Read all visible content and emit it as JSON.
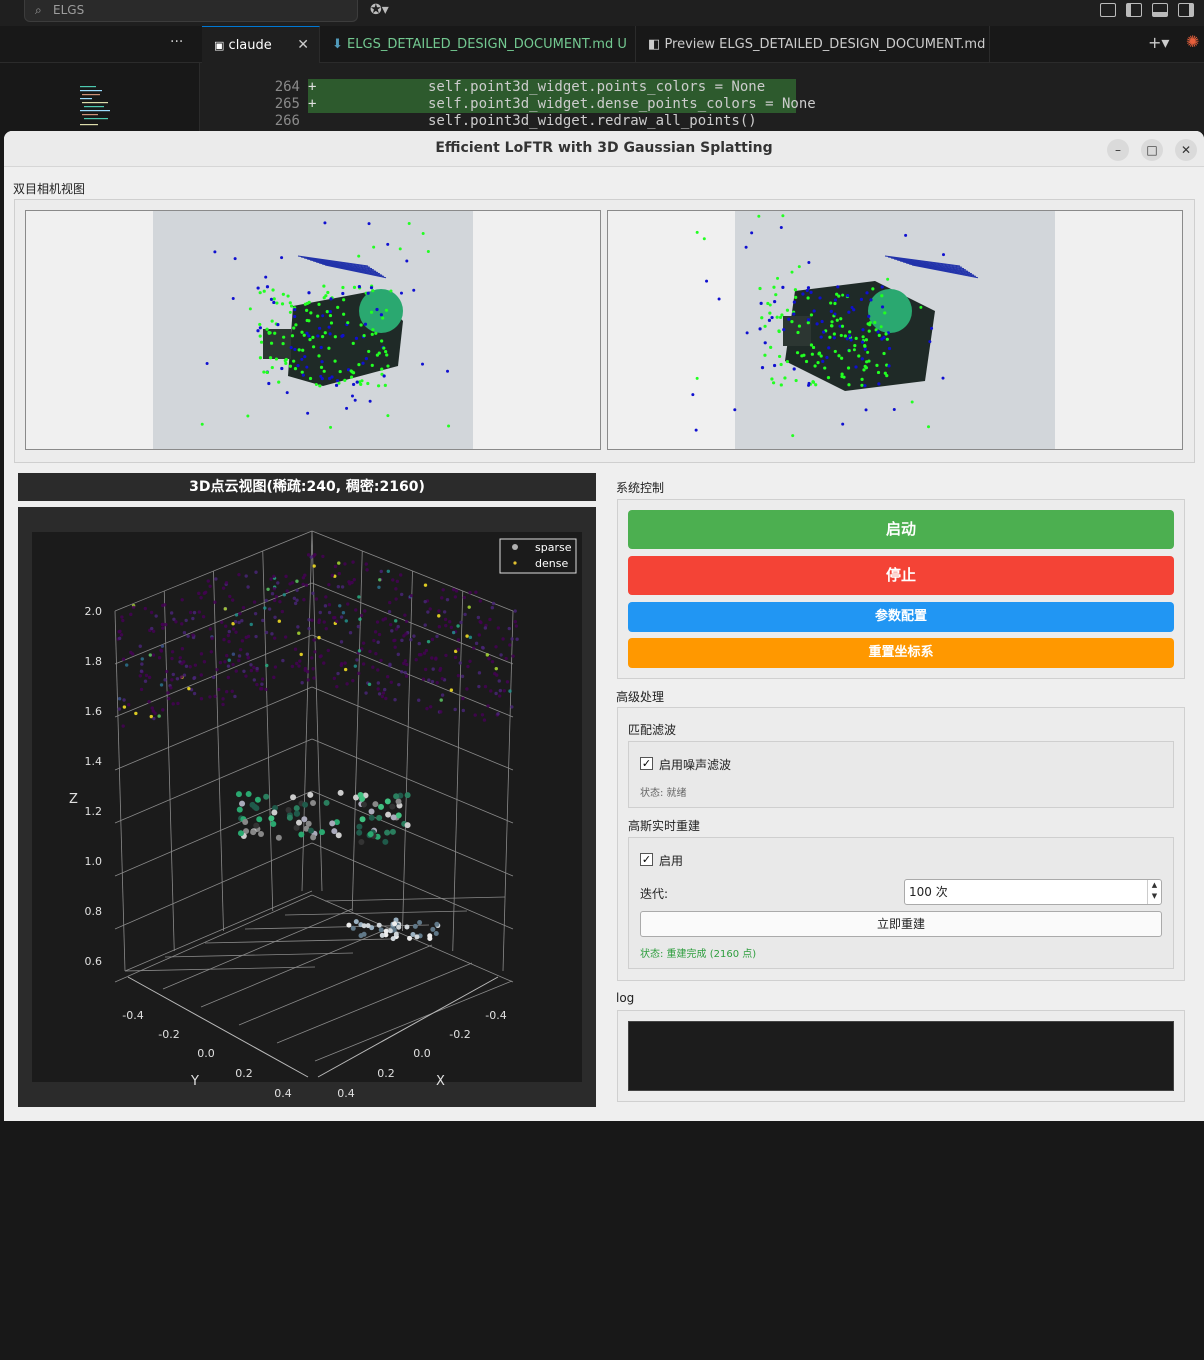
{
  "vscode": {
    "search_text": "ELGS",
    "tabs": [
      {
        "label": "claude",
        "icon": "terminal-icon",
        "active": true
      },
      {
        "label": "ELGS_DETAILED_DESIGN_DOCUMENT.md",
        "badge": "U",
        "icon": "markdown-icon"
      },
      {
        "label": "Preview ELGS_DETAILED_DESIGN_DOCUMENT.md",
        "icon": "preview-icon"
      }
    ],
    "code_lines": [
      {
        "num": "264",
        "marker": "+",
        "text": "self.point3d_widget.points_colors = None",
        "added": true
      },
      {
        "num": "265",
        "marker": "+",
        "text": "self.point3d_widget.dense_points_colors = None",
        "added": true
      },
      {
        "num": "266",
        "marker": "",
        "text": "self.point3d_widget.redraw_all_points()",
        "added": false
      }
    ]
  },
  "window": {
    "title": "Efficient LoFTR with 3D Gaussian Splatting"
  },
  "stereo": {
    "group_label": "双目相机视图"
  },
  "cloud": {
    "title": "3D点云视图(稀疏:240, 稠密:2160)"
  },
  "chart_data": {
    "type": "scatter",
    "title": "",
    "xlabel": "X",
    "ylabel": "Y",
    "zlabel": "Z",
    "zlim": [
      0.6,
      2.0
    ],
    "z_ticks": [
      "2.0",
      "1.8",
      "1.6",
      "1.4",
      "1.2",
      "1.0",
      "0.8",
      "0.6"
    ],
    "x_ticks": [
      "-0.4",
      "-0.2",
      "0.0",
      "0.2",
      "0.4"
    ],
    "y_ticks": [
      "-0.4",
      "-0.2",
      "0.0",
      "0.2",
      "0.4"
    ],
    "legend": {
      "placement": "top-right",
      "entries": [
        "sparse",
        "dense"
      ]
    },
    "series": [
      {
        "name": "sparse",
        "color": "#b0b0b0"
      },
      {
        "name": "dense",
        "color": "#e0c030"
      }
    ],
    "grid": true
  },
  "control": {
    "group_label": "系统控制",
    "start_label": "启动",
    "stop_label": "停止",
    "params_label": "参数配置",
    "reset_label": "重置坐标系",
    "colors": {
      "start": "#4caf50",
      "stop": "#f44336",
      "params": "#2196f3",
      "reset": "#ff9800"
    }
  },
  "advanced": {
    "group_label": "高级处理",
    "filter_label": "匹配滤波",
    "noise_filter_label": "启用噪声滤波",
    "noise_filter_checked": true,
    "filter_status": "状态: 就绪",
    "gauss_label": "高斯实时重建",
    "gauss_enable_label": "启用",
    "gauss_enable_checked": true,
    "iter_label": "迭代:",
    "iter_value": "100 次",
    "rebuild_label": "立即重建",
    "gauss_status": "状态: 重建完成 (2160 点)"
  },
  "log": {
    "group_label": "log"
  }
}
